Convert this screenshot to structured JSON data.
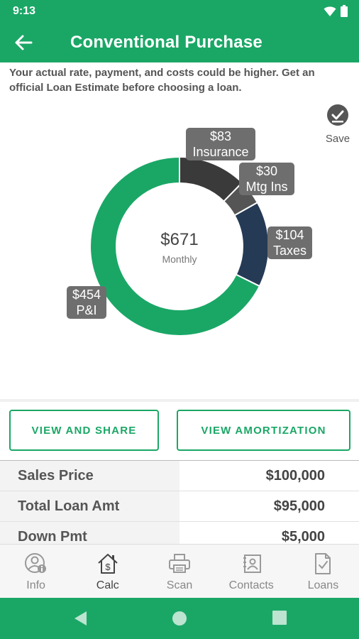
{
  "status_bar": {
    "time": "9:13"
  },
  "app_bar": {
    "title": "Conventional Purchase"
  },
  "disclaimer": "Your actual rate, payment, and costs could be higher. Get an official Loan Estimate before choosing a loan.",
  "save": {
    "label": "Save"
  },
  "chart_data": {
    "type": "pie",
    "center_value": "$671",
    "center_label": "Monthly",
    "total": 671,
    "slices": [
      {
        "name": "Insurance",
        "value": 83,
        "label_amount": "$83",
        "color": "#3a3a3a"
      },
      {
        "name": "Mtg Ins",
        "value": 30,
        "label_amount": "$30",
        "color": "#555555"
      },
      {
        "name": "Taxes",
        "value": 104,
        "label_amount": "$104",
        "color": "#253a55"
      },
      {
        "name": "P&I",
        "value": 454,
        "label_amount": "$454",
        "color": "#1aa766"
      }
    ]
  },
  "actions": {
    "view_share": "VIEW AND SHARE",
    "view_amortization": "VIEW AMORTIZATION"
  },
  "table": {
    "rows": [
      {
        "label": "Sales Price",
        "value": "$100,000"
      },
      {
        "label": "Total Loan Amt",
        "value": "$95,000"
      },
      {
        "label": "Down Pmt",
        "value": "$5,000"
      }
    ]
  },
  "bottom_nav": {
    "items": [
      {
        "label": "Info",
        "icon": "person-info-icon"
      },
      {
        "label": "Calc",
        "icon": "house-dollar-icon"
      },
      {
        "label": "Scan",
        "icon": "printer-icon"
      },
      {
        "label": "Contacts",
        "icon": "contacts-icon"
      },
      {
        "label": "Loans",
        "icon": "document-check-icon"
      }
    ],
    "active_index": 1
  },
  "colors": {
    "brand": "#1aa766",
    "label_bg": "#6e6e6e"
  }
}
